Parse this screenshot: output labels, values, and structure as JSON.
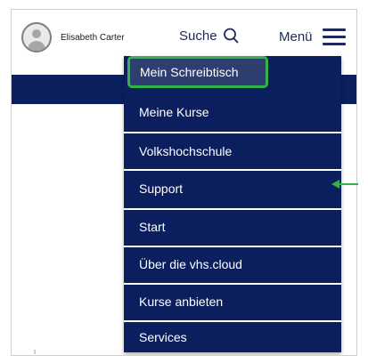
{
  "header": {
    "user_name": "Elisabeth Carter",
    "search_label": "Suche",
    "menu_label": "Menü",
    "brand_color": "#0b1f5e"
  },
  "menu": {
    "items": [
      {
        "label": "Mein Schreibtisch",
        "highlighted": true
      },
      {
        "label": "Meine Kurse"
      },
      {
        "label": "Volkshochschule"
      },
      {
        "label": "Support"
      },
      {
        "label": "Start"
      },
      {
        "label": "Über die vhs.cloud"
      },
      {
        "label": "Kurse anbieten"
      },
      {
        "label": "Services"
      }
    ],
    "highlight_color": "#2fb34a"
  },
  "icons": [
    "avatar-icon",
    "search-icon",
    "hamburger-icon",
    "arrow-pointer-icon"
  ]
}
